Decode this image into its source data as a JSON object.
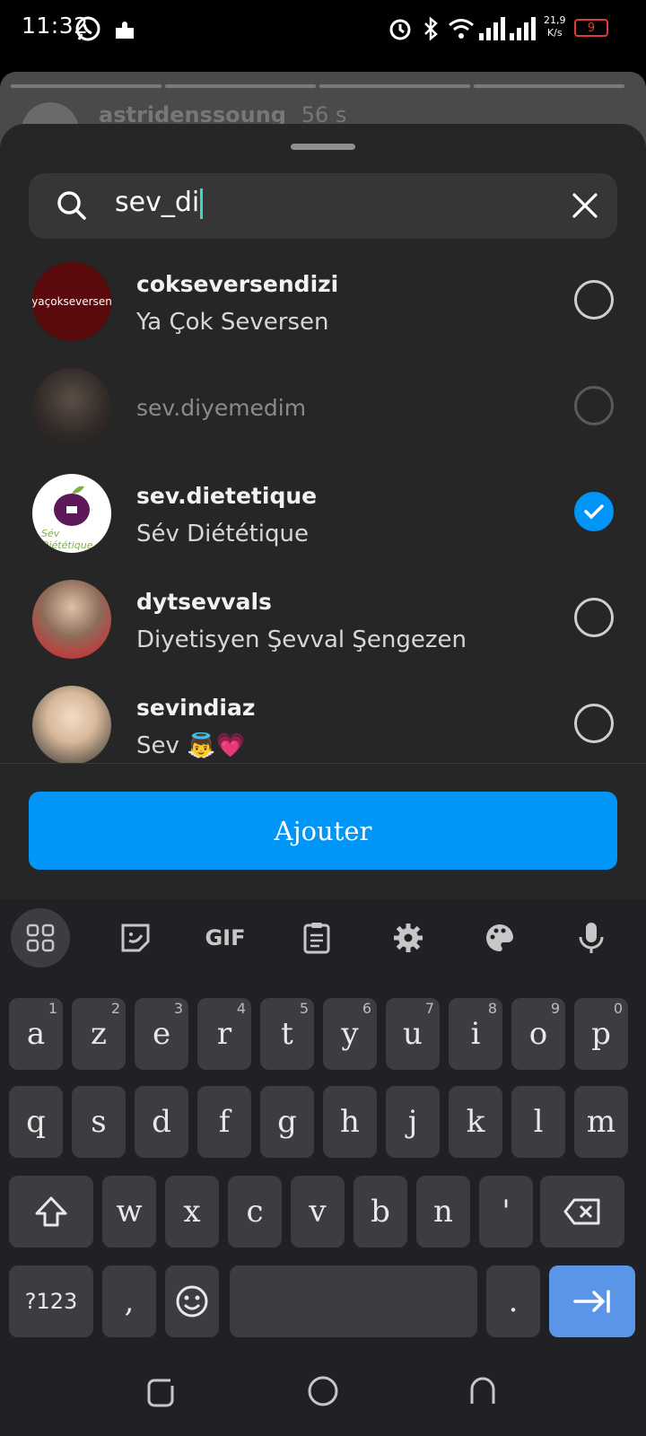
{
  "status": {
    "time": "11:32",
    "speed_value": "21,9",
    "speed_unit": "K/s",
    "battery": "9"
  },
  "story": {
    "username": "astridenssoung",
    "age": "56 s"
  },
  "search": {
    "query": "sev_di"
  },
  "results": [
    {
      "username": "cokseversendizi",
      "full_name": "Ya Çok Seversen",
      "avatar_text": "yaçokseversen",
      "selected": false
    },
    {
      "username": "sev.diyemedim",
      "full_name": "",
      "selected": false
    },
    {
      "username": "sev.dietetique",
      "full_name": "Sév Diététique",
      "avatar_text": "Sév Diététique",
      "selected": true
    },
    {
      "username": "dytsevvals",
      "full_name": "Diyetisyen Şevval Şengezen",
      "selected": false
    },
    {
      "username": "sevindiaz",
      "full_name": "Sev 👼💗",
      "selected": false
    }
  ],
  "add_button": {
    "label": "Ajouter"
  },
  "keyboard": {
    "toolbar_gif": "GIF",
    "row1": [
      {
        "k": "a",
        "h": "1"
      },
      {
        "k": "z",
        "h": "2"
      },
      {
        "k": "e",
        "h": "3"
      },
      {
        "k": "r",
        "h": "4"
      },
      {
        "k": "t",
        "h": "5"
      },
      {
        "k": "y",
        "h": "6"
      },
      {
        "k": "u",
        "h": "7"
      },
      {
        "k": "i",
        "h": "8"
      },
      {
        "k": "o",
        "h": "9"
      },
      {
        "k": "p",
        "h": "0"
      }
    ],
    "row2": [
      "q",
      "s",
      "d",
      "f",
      "g",
      "h",
      "j",
      "k",
      "l",
      "m"
    ],
    "row3": [
      "w",
      "x",
      "c",
      "v",
      "b",
      "n",
      "'"
    ],
    "symbols_label": "?123",
    "comma": ",",
    "period": "."
  },
  "colors": {
    "accent": "#0095f6",
    "sheet": "#262626",
    "keyboard": "#202124",
    "key": "#3c3d40",
    "enter": "#5b95e8"
  }
}
